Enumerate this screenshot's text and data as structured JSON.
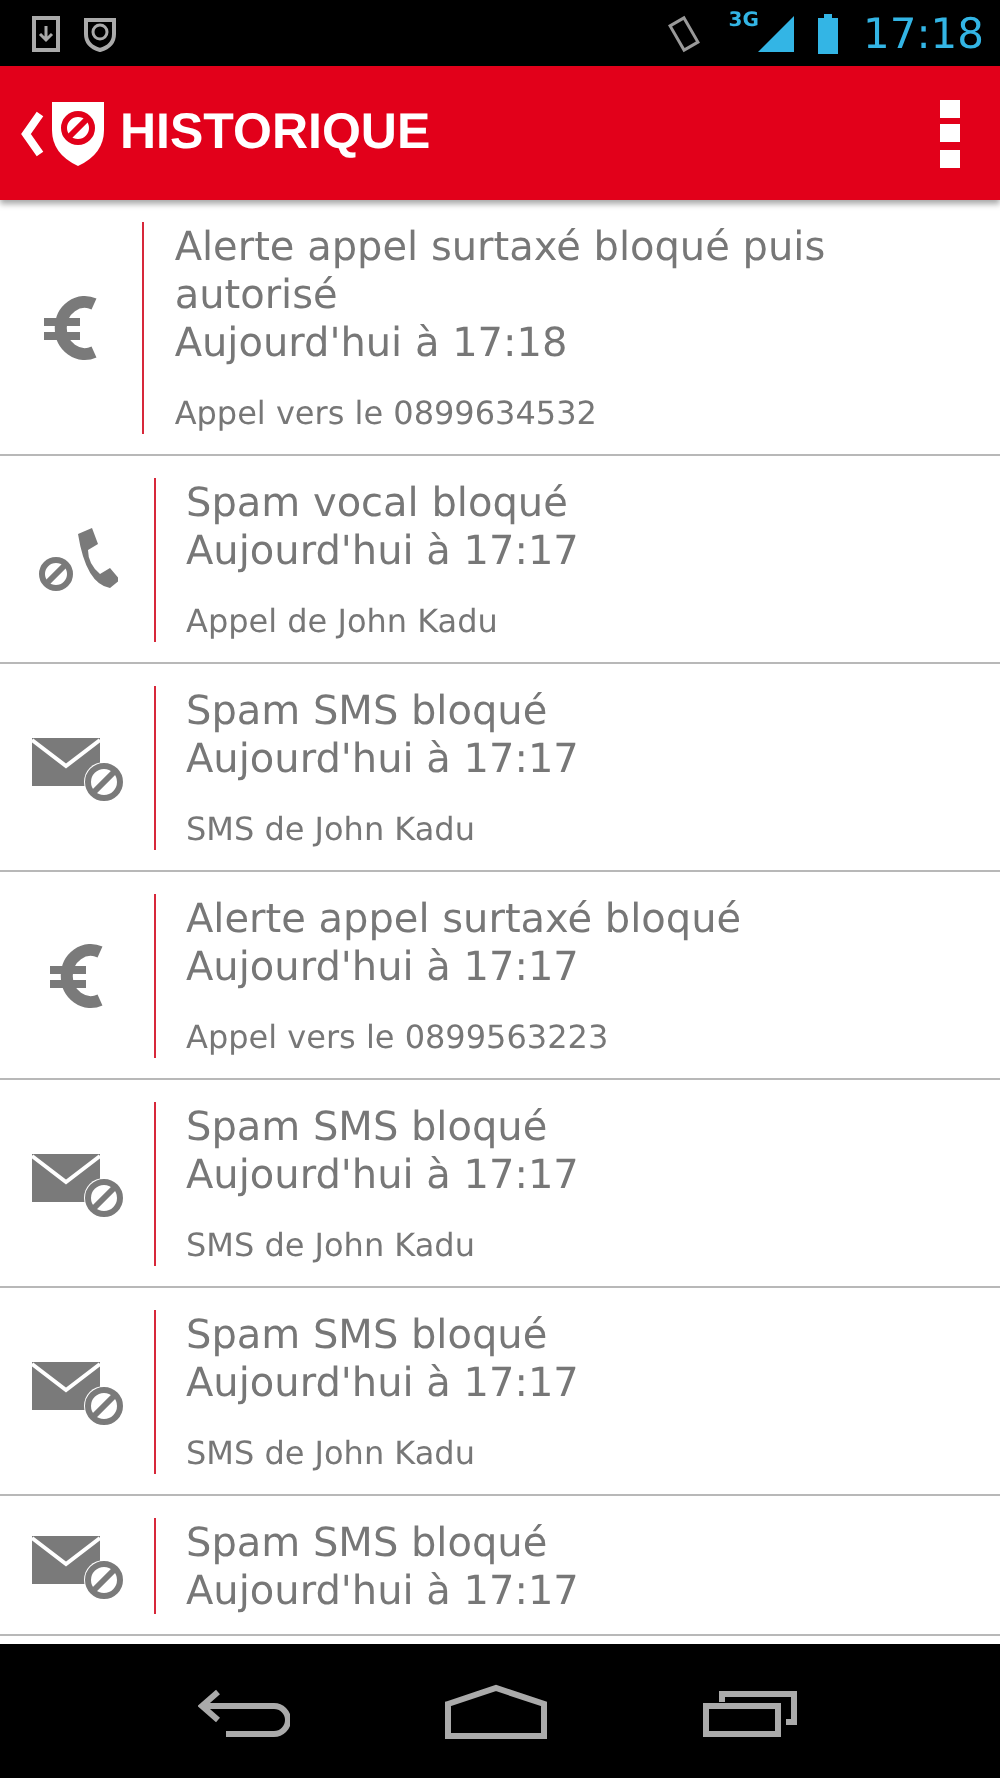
{
  "status_bar": {
    "network": "3G",
    "time": "17:18"
  },
  "header": {
    "title": "HISTORIQUE"
  },
  "history": [
    {
      "kind": "euro",
      "title": "Alerte appel surtaxé bloqué puis autorisé",
      "time": "Aujourd'hui à 17:18",
      "detail": "Appel vers le 0899634532"
    },
    {
      "kind": "call-blocked",
      "title": "Spam vocal bloqué",
      "time": "Aujourd'hui à 17:17",
      "detail": "Appel de John Kadu"
    },
    {
      "kind": "sms-blocked",
      "title": "Spam SMS bloqué",
      "time": "Aujourd'hui à 17:17",
      "detail": "SMS de John Kadu"
    },
    {
      "kind": "euro",
      "title": "Alerte appel surtaxé bloqué",
      "time": "Aujourd'hui à 17:17",
      "detail": "Appel vers le 0899563223"
    },
    {
      "kind": "sms-blocked",
      "title": "Spam SMS bloqué",
      "time": "Aujourd'hui à 17:17",
      "detail": "SMS de John Kadu"
    },
    {
      "kind": "sms-blocked",
      "title": "Spam SMS bloqué",
      "time": "Aujourd'hui à 17:17",
      "detail": "SMS de John Kadu"
    },
    {
      "kind": "sms-blocked",
      "title": "Spam SMS bloqué",
      "time": "Aujourd'hui à 17:17"
    }
  ]
}
